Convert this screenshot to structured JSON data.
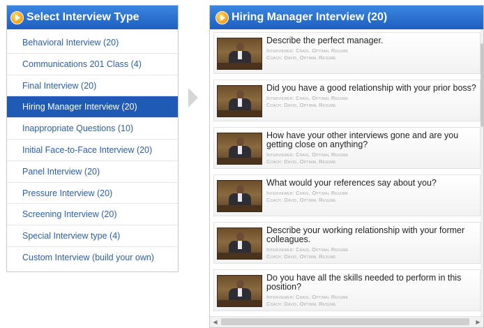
{
  "left_panel": {
    "title": "Select Interview Type",
    "items": [
      {
        "label": "Behavioral Interview (20)"
      },
      {
        "label": "Communications 201 Class (4)"
      },
      {
        "label": "Final Interview (20)"
      },
      {
        "label": "Hiring Manager Interview (20)",
        "selected": true
      },
      {
        "label": "Inappropriate Questions (10)"
      },
      {
        "label": "Initial Face-to-Face Interview (20)"
      },
      {
        "label": "Panel Interview (20)"
      },
      {
        "label": "Pressure Interview (20)"
      },
      {
        "label": "Screening Interview (20)"
      },
      {
        "label": "Special Interview type (4)"
      },
      {
        "label": "Custom Interview (build your own)"
      }
    ]
  },
  "right_panel": {
    "title": "Hiring Manager Interview (20)",
    "questions": [
      {
        "title": "Describe the perfect manager.",
        "interviewer": "Interviewer: Craig, Optimal Resume",
        "coach": "Coach: David, Optimal Resume"
      },
      {
        "title": "Did you have a good relationship with your prior boss?",
        "interviewer": "Interviewer: Craig, Optimal Resume",
        "coach": "Coach: David, Optimal Resume"
      },
      {
        "title": "How have your other interviews gone and are you getting close on anything?",
        "interviewer": "Interviewer: Craig, Optimal Resume",
        "coach": "Coach: David, Optimal Resume"
      },
      {
        "title": "What would your references say about you?",
        "interviewer": "Interviewer: Craig, Optimal Resume",
        "coach": "Coach: David, Optimal Resume"
      },
      {
        "title": "Describe your working relationship with your former colleagues.",
        "interviewer": "Interviewer: Craig, Optimal Resume",
        "coach": "Coach: David, Optimal Resume"
      },
      {
        "title": "Do you have all the skills needed to perform in this position?",
        "interviewer": "Interviewer: Craig, Optimal Resume",
        "coach": "Coach: David, Optimal Resume"
      }
    ]
  },
  "icons": {
    "header_icon": "play-circle-icon",
    "scroll_left": "chevron-left-icon",
    "scroll_right": "chevron-right-icon"
  },
  "colors": {
    "header_blue": "#1e5fbf",
    "selected_blue": "#1f5bb5",
    "link_blue": "#2a5fa8",
    "play_orange": "#f0a014"
  }
}
